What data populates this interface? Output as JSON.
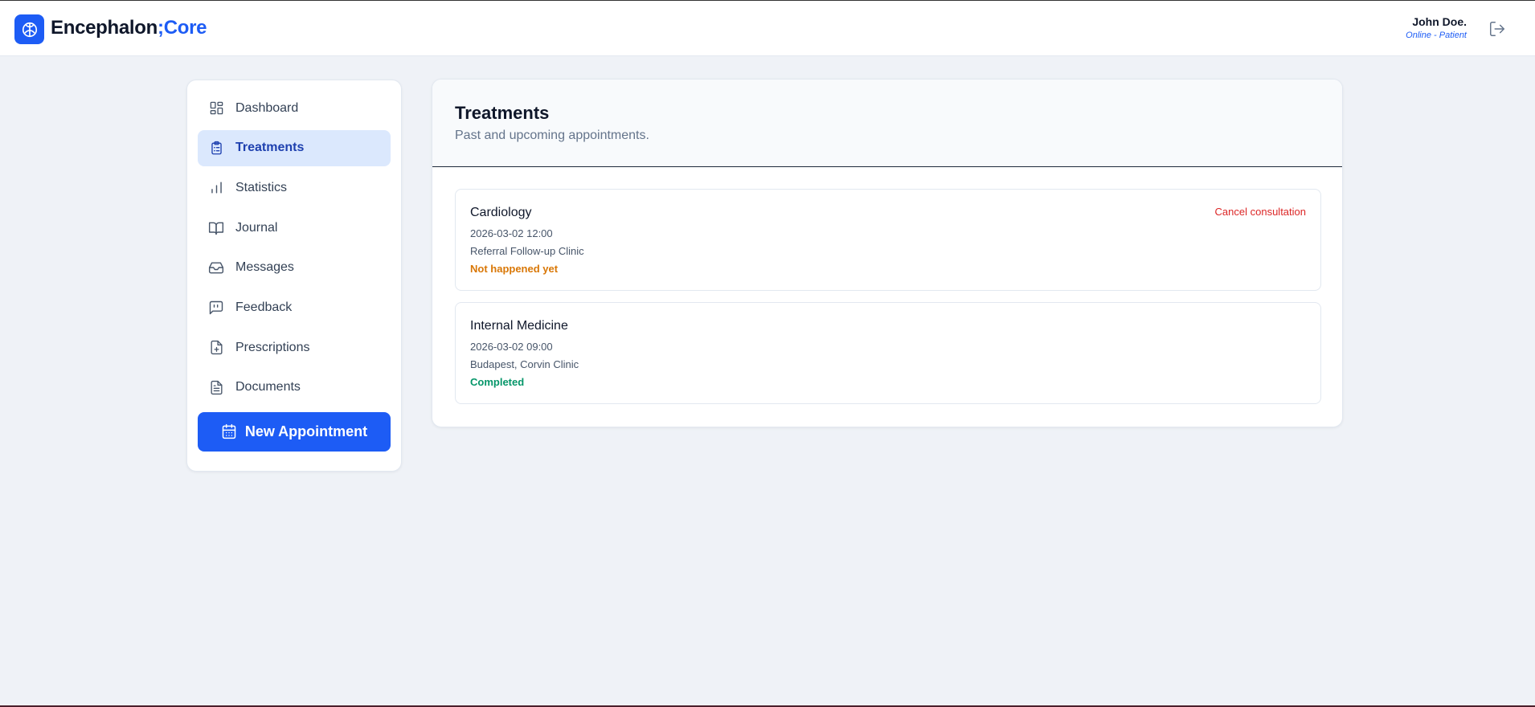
{
  "header": {
    "brand_primary": "Encephalon",
    "brand_accent": ";Core",
    "brand_icon": "brain-icon",
    "user_name": "John Doe.",
    "user_status": "Online - Patient",
    "logout_icon": "logout-icon"
  },
  "sidebar": {
    "items": [
      {
        "label": "Dashboard",
        "icon": "dashboard-icon",
        "active": false
      },
      {
        "label": "Treatments",
        "icon": "clipboard-list-icon",
        "active": true
      },
      {
        "label": "Statistics",
        "icon": "bar-chart-icon",
        "active": false
      },
      {
        "label": "Journal",
        "icon": "book-open-icon",
        "active": false
      },
      {
        "label": "Messages",
        "icon": "inbox-icon",
        "active": false
      },
      {
        "label": "Feedback",
        "icon": "message-quote-icon",
        "active": false
      },
      {
        "label": "Prescriptions",
        "icon": "file-plus-icon",
        "active": false
      },
      {
        "label": "Documents",
        "icon": "file-text-icon",
        "active": false
      }
    ],
    "new_appointment_label": "New Appointment",
    "new_appointment_icon": "calendar-icon"
  },
  "main": {
    "title": "Treatments",
    "subtitle": "Past and upcoming appointments.",
    "appointments": [
      {
        "title": "Cardiology",
        "datetime": "2026-03-02 12:00",
        "location": "Referral Follow-up Clinic",
        "status": "Not happened yet",
        "action": "Cancel consultation"
      },
      {
        "title": "Internal Medicine",
        "datetime": "2026-03-02 09:00",
        "location": "Budapest, Corvin Clinic",
        "status": "Completed"
      }
    ]
  },
  "colors": {
    "accent": "#1d5cf5",
    "background": "#eff2f7",
    "active_nav_bg": "#dbe8fd",
    "status_pending": "#d97706",
    "status_completed": "#059669",
    "danger": "#dc2626"
  }
}
